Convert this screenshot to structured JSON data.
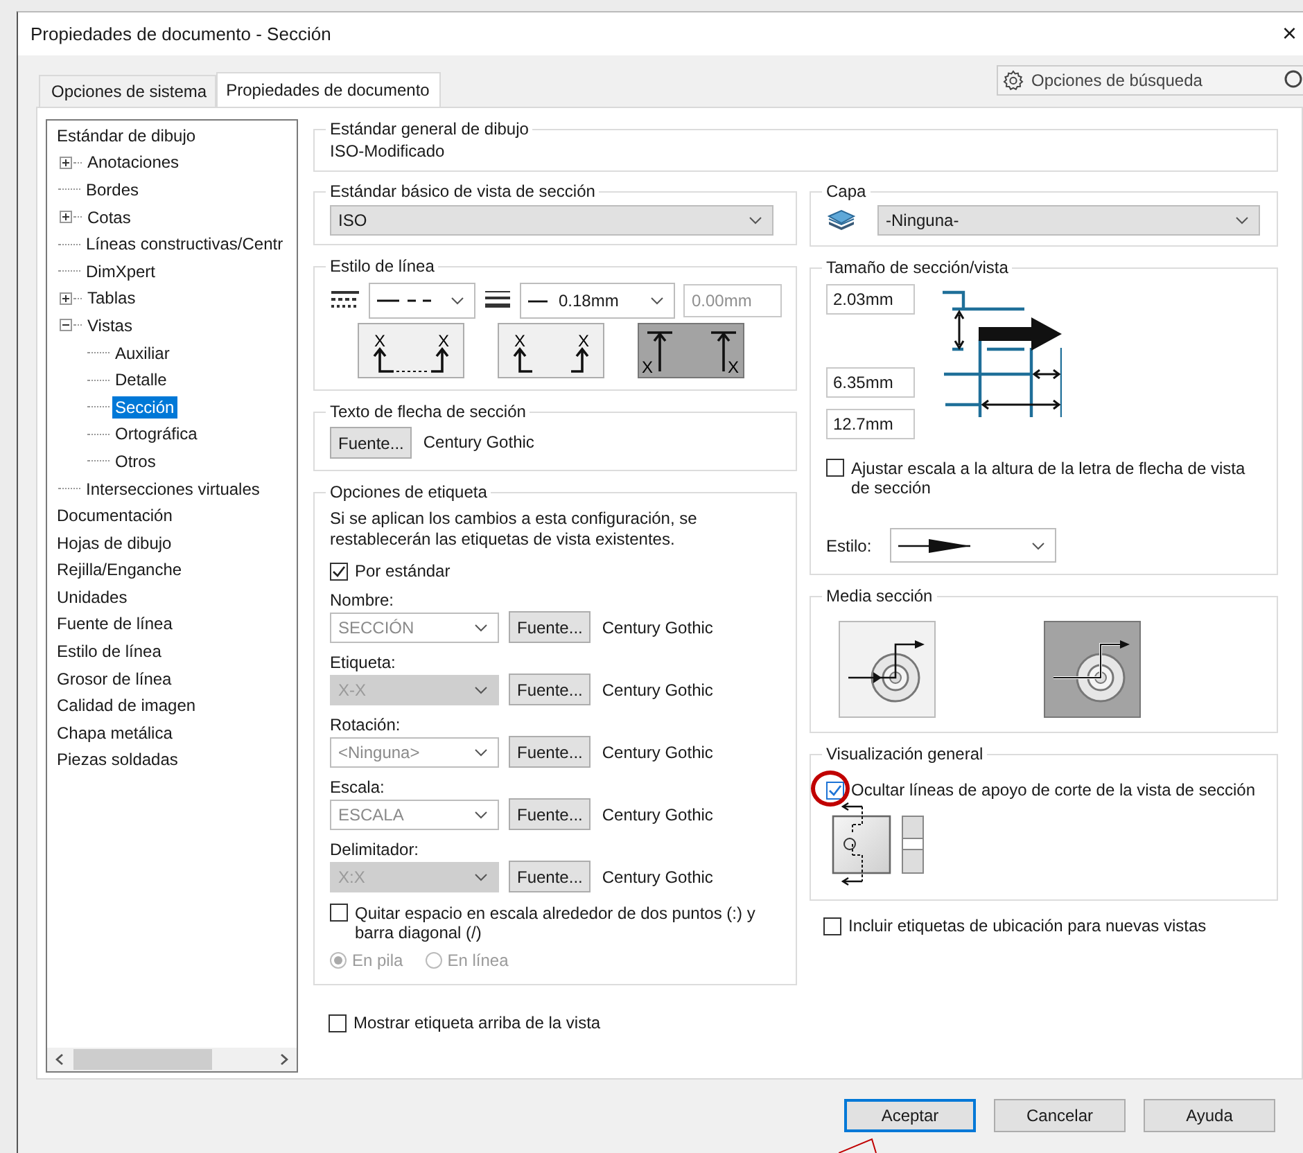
{
  "window": {
    "title": "Propiedades de documento - Sección",
    "close": "×"
  },
  "tabs": [
    {
      "label": "Opciones de sistema",
      "selected": false
    },
    {
      "label": "Propiedades de documento",
      "selected": true
    }
  ],
  "search": {
    "placeholder": "Opciones de búsqueda"
  },
  "tree": {
    "items": [
      {
        "label": "Estándar de dibujo",
        "selected": false,
        "children": [
          {
            "label": "Anotaciones",
            "expanded": false,
            "selected": false
          },
          {
            "label": "Bordes",
            "selected": false
          },
          {
            "label": "Cotas",
            "expanded": false,
            "selected": false
          },
          {
            "label": "Líneas constructivas/Centr",
            "selected": false
          },
          {
            "label": "DimXpert",
            "selected": false
          },
          {
            "label": "Tablas",
            "expanded": false,
            "selected": false
          },
          {
            "label": "Vistas",
            "expanded": true,
            "selected": false,
            "children": [
              {
                "label": "Auxiliar",
                "selected": false
              },
              {
                "label": "Detalle",
                "selected": false
              },
              {
                "label": "Sección",
                "selected": true
              },
              {
                "label": "Ortográfica",
                "selected": false
              },
              {
                "label": "Otros",
                "selected": false
              }
            ]
          },
          {
            "label": "Intersecciones virtuales",
            "selected": false
          }
        ]
      },
      {
        "label": "Documentación",
        "selected": false
      },
      {
        "label": "Hojas de dibujo",
        "selected": false
      },
      {
        "label": "Rejilla/Enganche",
        "selected": false
      },
      {
        "label": "Unidades",
        "selected": false
      },
      {
        "label": "Fuente de línea",
        "selected": false
      },
      {
        "label": "Estilo de línea",
        "selected": false
      },
      {
        "label": "Grosor de línea",
        "selected": false
      },
      {
        "label": "Calidad de imagen",
        "selected": false
      },
      {
        "label": "Chapa metálica",
        "selected": false
      },
      {
        "label": "Piezas soldadas",
        "selected": false
      }
    ]
  },
  "general_standard": {
    "legend": "Estándar general de dibujo",
    "value": "ISO-Modificado"
  },
  "section_standard": {
    "legend": "Estándar básico de vista de sección",
    "value": "ISO"
  },
  "line_style": {
    "legend": "Estilo de línea",
    "thickness": "0.18mm",
    "custom_thickness": "0.00mm",
    "arrow_options": [
      {
        "letters": [
          "X",
          "X"
        ],
        "selected": false
      },
      {
        "letters": [
          "X",
          "X"
        ],
        "selected": false
      },
      {
        "letters": [
          "X",
          "X"
        ],
        "selected": true
      }
    ]
  },
  "arrow_text": {
    "legend": "Texto de flecha de sección",
    "button": "Fuente...",
    "font": "Century Gothic"
  },
  "label_options": {
    "legend": "Opciones de etiqueta",
    "note": "Si se aplican los cambios a esta configuración, se restablecerán las etiquetas de vista existentes.",
    "by_standard": {
      "label": "Por estándar",
      "checked": true
    },
    "fields": [
      {
        "label": "Nombre:",
        "value": "SECCIÓN",
        "disabled": false,
        "button": "Fuente...",
        "font": "Century Gothic"
      },
      {
        "label": "Etiqueta:",
        "value": "X-X",
        "disabled": true,
        "button": "Fuente...",
        "font": "Century Gothic"
      },
      {
        "label": "Rotación:",
        "value": "<Ninguna>",
        "disabled": false,
        "button": "Fuente...",
        "font": "Century Gothic"
      },
      {
        "label": "Escala:",
        "value": "ESCALA",
        "disabled": false,
        "button": "Fuente...",
        "font": "Century Gothic"
      },
      {
        "label": "Delimitador:",
        "value": "X:X",
        "disabled": true,
        "button": "Fuente...",
        "font": "Century Gothic"
      }
    ],
    "remove_space": {
      "label": "Quitar espacio en escala alrededor de dos puntos (:) y barra diagonal (/)",
      "checked": false
    },
    "layout_radios": [
      {
        "label": "En pila",
        "selected": true
      },
      {
        "label": "En línea",
        "selected": false
      }
    ]
  },
  "show_label_above": {
    "label": "Mostrar etiqueta arriba de la vista",
    "checked": false
  },
  "layer": {
    "legend": "Capa",
    "value": "-Ninguna-"
  },
  "section_size": {
    "legend": "Tamaño de sección/vista",
    "values": [
      "2.03mm",
      "6.35mm",
      "12.7mm"
    ],
    "scale_checkbox": {
      "label": "Ajustar escala a la altura de la letra de flecha de vista de sección",
      "checked": false
    },
    "style_label": "Estilo:"
  },
  "half_section": {
    "legend": "Media sección",
    "options": [
      {
        "selected": false
      },
      {
        "selected": true
      }
    ]
  },
  "display": {
    "legend": "Visualización general",
    "hide_lines": {
      "label": "Ocultar líneas de apoyo de corte de la vista de sección",
      "checked": true
    }
  },
  "include_labels": {
    "label": "Incluir etiquetas de ubicación para nuevas vistas",
    "checked": false
  },
  "buttons": [
    {
      "label": "Aceptar",
      "default": true
    },
    {
      "label": "Cancelar",
      "default": false
    },
    {
      "label": "Ayuda",
      "default": false
    }
  ]
}
